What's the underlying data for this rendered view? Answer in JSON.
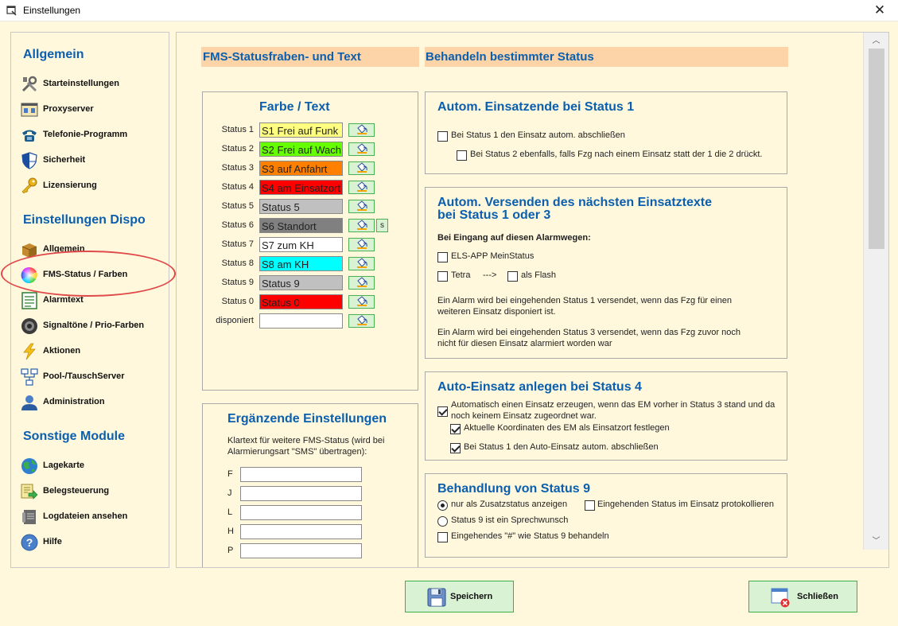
{
  "window": {
    "title": "Einstellungen",
    "close_glyph": "✕"
  },
  "nav": {
    "sections": [
      {
        "title": "Allgemein"
      },
      {
        "title": "Einstellungen Dispo"
      },
      {
        "title": "Sonstige Module"
      }
    ],
    "items": [
      {
        "label": "Starteinstellungen",
        "icon": "tools-icon"
      },
      {
        "label": "Proxyserver",
        "icon": "proxy-icon"
      },
      {
        "label": "Telefonie-Programm",
        "icon": "telephone-icon"
      },
      {
        "label": "Sicherheit",
        "icon": "shield-icon"
      },
      {
        "label": "Lizensierung",
        "icon": "key-icon"
      },
      {
        "label": "Allgemein",
        "icon": "box-icon"
      },
      {
        "label": "FMS-Status / Farben",
        "icon": "color-wheel-icon",
        "selected": true
      },
      {
        "label": "Alarmtext",
        "icon": "document-icon"
      },
      {
        "label": "Signaltöne / Prio-Farben",
        "icon": "speaker-icon"
      },
      {
        "label": "Aktionen",
        "icon": "lightning-icon"
      },
      {
        "label": "Pool-/TauschServer",
        "icon": "network-icon"
      },
      {
        "label": "Administration",
        "icon": "user-icon"
      },
      {
        "label": "Lagekarte",
        "icon": "globe-icon"
      },
      {
        "label": "Belegsteuerung",
        "icon": "forward-document-icon"
      },
      {
        "label": "Logdateien ansehen",
        "icon": "log-icon"
      },
      {
        "label": "Hilfe",
        "icon": "help-icon"
      }
    ]
  },
  "main": {
    "left_header": "FMS-Statusfraben- und Text",
    "right_header": "Behandeln bestimmter Status",
    "farbe_text": {
      "title": "Farbe / Text",
      "rows": [
        {
          "label": "Status 1",
          "text": "S1 Frei auf Funk",
          "bg": "#ffff80",
          "fg": "#000000"
        },
        {
          "label": "Status 2",
          "text": "S2 Frei auf Wach",
          "bg": "#66ff00",
          "fg": "#000000"
        },
        {
          "label": "Status 3",
          "text": "S3 auf Anfahrt",
          "bg": "#ff8000",
          "fg": "#000000"
        },
        {
          "label": "Status 4",
          "text": "S4 am Einsatzort",
          "bg": "#ff0000",
          "fg": "#000000"
        },
        {
          "label": "Status 5",
          "text": "Status 5",
          "bg": "#c0c0c0",
          "fg": "#000000"
        },
        {
          "label": "Status 6",
          "text": "S6 Standort",
          "bg": "#808080",
          "fg": "#000000"
        },
        {
          "label": "Status 7",
          "text": "S7 zum KH",
          "bg": "#ffffff",
          "fg": "#000000"
        },
        {
          "label": "Status 8",
          "text": "S8 am KH",
          "bg": "#00ffff",
          "fg": "#000000"
        },
        {
          "label": "Status 9",
          "text": "Status 9",
          "bg": "#c0c0c0",
          "fg": "#000000"
        },
        {
          "label": "Status 0",
          "text": "Status 0",
          "bg": "#ff0000",
          "fg": "#000000"
        },
        {
          "label": "disponiert",
          "text": "",
          "bg": "#ffffff",
          "fg": "#000000"
        }
      ],
      "s_button_label": "s"
    },
    "ergaenzende": {
      "title": "Ergänzende Einstellungen",
      "desc": [
        "Klartext für weitere FMS-Status (wird bei",
        "Alarmierungsart \"SMS\" übertragen):"
      ],
      "fields": [
        {
          "label": "F",
          "value": ""
        },
        {
          "label": "J",
          "value": ""
        },
        {
          "label": "L",
          "value": ""
        },
        {
          "label": "H",
          "value": ""
        },
        {
          "label": "P",
          "value": ""
        }
      ]
    },
    "status1": {
      "title": "Autom. Einsatzende bei Status 1",
      "cb1": {
        "label": "Bei Status 1 den Einsatz autom. abschließen",
        "checked": false
      },
      "cb2": {
        "label": "Bei Status 2 ebenfalls, falls Fzg nach einem Einsatz statt der 1 die 2 drückt.",
        "checked": false
      }
    },
    "versenden": {
      "title_line1": "Autom. Versenden des nächsten Einsatztexte",
      "title_line2": "bei Status 1 oder 3",
      "sub": "Bei Eingang auf diesen Alarmwegen:",
      "els": {
        "label": "ELS-APP MeinStatus",
        "checked": false
      },
      "tetra": {
        "label": "Tetra",
        "checked": false
      },
      "arrow": "--->",
      "flash": {
        "label": "als Flash",
        "checked": false
      },
      "info1": [
        "Ein Alarm wird bei eingehenden Status 1 versendet, wenn das Fzg für einen",
        "weiteren Einsatz disponiert ist."
      ],
      "info2": [
        "Ein Alarm wird bei eingehenden Status 3 versendet, wenn das Fzg zuvor noch",
        "nicht für diesen Einsatz alarmiert worden war"
      ]
    },
    "status4": {
      "title": "Auto-Einsatz anlegen bei Status 4",
      "cb1": {
        "label_line1": "Automatisch einen Einsatz erzeugen, wenn  das EM vorher in Status 3 stand und da",
        "label_line2": "noch keinem Einsatz zugeordnet war.",
        "checked": true
      },
      "cb2": {
        "label": "Aktuelle Koordinaten des EM als Einsatzort festlegen",
        "checked": true
      },
      "cb3": {
        "label": "Bei Status 1 den Auto-Einsatz autom. abschließen",
        "checked": true
      }
    },
    "status9": {
      "title": "Behandlung von Status 9",
      "radio1": {
        "label": "nur als Zusatzstatus anzeigen",
        "checked": true
      },
      "radio2": {
        "label": "Status 9 ist ein Sprechwunsch",
        "checked": false
      },
      "cb_protokoll": {
        "label": "Eingehenden Status im Einsatz protokollieren",
        "checked": false
      },
      "cb_hash": {
        "label": "Eingehendes \"#\" wie Status 9 behandeln",
        "checked": false
      }
    }
  },
  "buttons": {
    "save": {
      "label": "Speichern",
      "icon": "floppy-disk-icon"
    },
    "close": {
      "label": "Schließen",
      "icon": "close-window-icon"
    }
  }
}
